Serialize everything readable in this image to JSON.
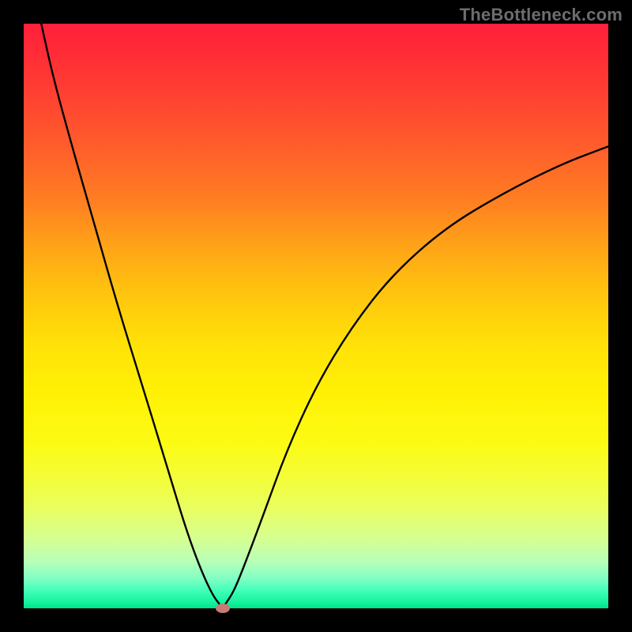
{
  "watermark": "TheBottleneck.com",
  "chart_data": {
    "type": "line",
    "title": "",
    "xlabel": "",
    "ylabel": "",
    "xlim": [
      0,
      100
    ],
    "ylim": [
      0,
      100
    ],
    "grid": false,
    "legend": false,
    "series": [
      {
        "name": "bottleneck-curve",
        "x": [
          3,
          5,
          8,
          12,
          16,
          20,
          24,
          27,
          29,
          31,
          32.5,
          33.5,
          34,
          34.5,
          36,
          38,
          41,
          45,
          50,
          56,
          63,
          72,
          82,
          92,
          100
        ],
        "y": [
          100,
          91,
          80,
          66,
          52,
          39,
          26,
          16,
          10,
          5,
          2,
          0.7,
          0,
          0.7,
          3,
          8,
          16,
          27,
          38,
          48,
          57,
          65,
          71,
          76,
          79
        ]
      }
    ],
    "marker": {
      "name": "optimum",
      "x": 34,
      "y": 0
    },
    "gradient_colors": {
      "top": "#ff1f3a",
      "mid": "#ffe208",
      "bottom": "#00e389"
    }
  }
}
